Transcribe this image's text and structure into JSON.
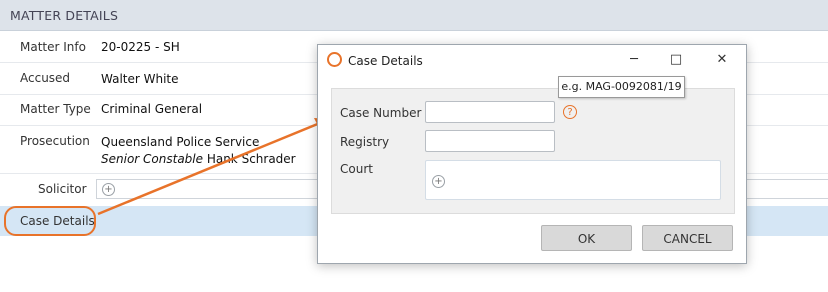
{
  "section": {
    "title": "MATTER DETAILS"
  },
  "fields": {
    "matter_info": {
      "label": "Matter Info",
      "value": "20-0225 - SH"
    },
    "accused": {
      "label": "Accused",
      "value": "Walter White"
    },
    "matter_type": {
      "label": "Matter Type",
      "value": "Criminal General"
    },
    "prosecution": {
      "label": "Prosecution",
      "value": "Queensland Police Service",
      "officer_rank": "Senior Constable",
      "officer_name": "Hank Schrader"
    },
    "solicitor": {
      "label": "Solicitor"
    },
    "case_details": {
      "label": "Case Details"
    }
  },
  "dialog": {
    "title": "Case Details",
    "case_number_label": "Case Number",
    "case_number_value": "",
    "registry_label": "Registry",
    "registry_value": "",
    "court_label": "Court",
    "tooltip": "e.g. MAG-0092081/19",
    "help_symbol": "?",
    "ok_label": "OK",
    "cancel_label": "CANCEL",
    "minimize_symbol": "─",
    "maximize_symbol": "□",
    "close_symbol": "✕"
  },
  "colors": {
    "accent": "#e8732a",
    "header_bg": "#dde3ea",
    "selected_row": "#d5e6f5"
  },
  "icons": {
    "add": "plus-circle-icon",
    "help": "question-circle-icon",
    "logo": "app-logo-icon"
  }
}
